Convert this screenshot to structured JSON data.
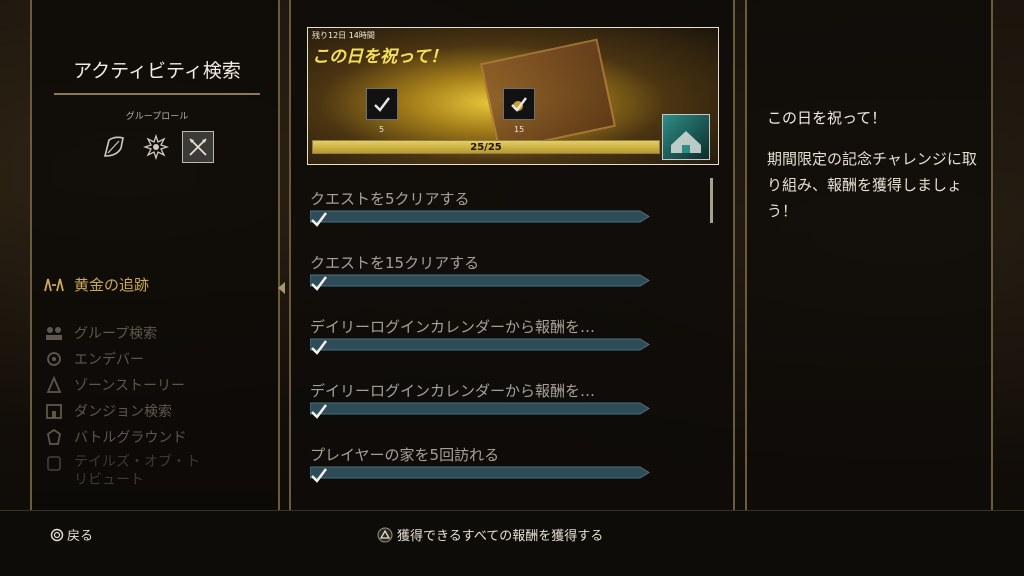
{
  "sidebar": {
    "title": "アクティビティ検索",
    "role_label": "グループロール",
    "roles": [
      {
        "icon": "shield-icon",
        "selected": false
      },
      {
        "icon": "healer-burst-icon",
        "selected": false
      },
      {
        "icon": "crossed-swords-icon",
        "selected": true
      }
    ],
    "selected_item": "黄金の追跡",
    "items": [
      {
        "label": "グループ検索",
        "icon": "group-icon"
      },
      {
        "label": "エンデバー",
        "icon": "endeavor-icon"
      },
      {
        "label": "ゾーンストーリー",
        "icon": "zone-story-icon"
      },
      {
        "label": "ダンジョン検索",
        "icon": "dungeon-icon"
      },
      {
        "label": "バトルグラウンド",
        "icon": "battleground-icon"
      },
      {
        "label": "テイルズ・オブ・トリビュート",
        "icon": "tribute-icon"
      }
    ]
  },
  "banner": {
    "time_remaining": "残り12日 14時間",
    "title": "この日を祝って！",
    "rewards": [
      {
        "count": "5",
        "icon": "checkmark-reward-icon"
      },
      {
        "count": "15",
        "icon": "gold-checkmark-reward-icon"
      }
    ],
    "progress_text": "25/25",
    "progress": 1.0,
    "final_reward_icon": "house-reward-icon"
  },
  "quests": [
    {
      "label": "クエストを5クリアする",
      "progress": 1.0
    },
    {
      "label": "クエストを15クリアする",
      "progress": 1.0
    },
    {
      "label": "デイリーログインカレンダーから報酬を…",
      "progress": 1.0
    },
    {
      "label": "デイリーログインカレンダーから報酬を…",
      "progress": 1.0
    },
    {
      "label": "プレイヤーの家を5回訪れる",
      "progress": 1.0
    }
  ],
  "detail": {
    "title": "この日を祝って！",
    "description": "期間限定の記念チャレンジに取り組み、報酬を獲得しましょう！"
  },
  "footer": {
    "back_label": "戻る",
    "claim_label": "獲得できるすべての報酬を獲得する"
  },
  "colors": {
    "accent_gold": "#c9a95a",
    "bar_teal": "#2e4b58",
    "banner_bar": "#d4bd4c"
  }
}
